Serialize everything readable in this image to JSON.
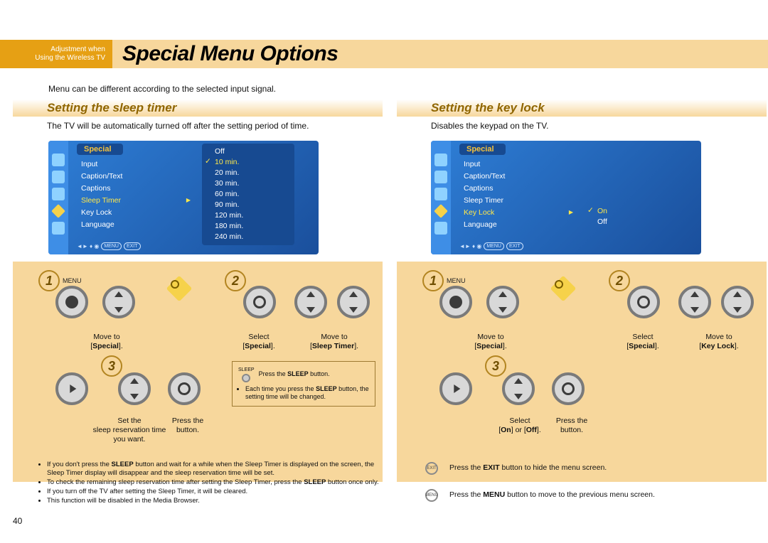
{
  "header": {
    "tab_line1": "Adjustment when",
    "tab_line2": "Using the Wireless TV",
    "title": "Special Menu Options"
  },
  "intro": "Menu can be different according to the selected input signal.",
  "page_number": "40",
  "sleep": {
    "title": "Setting the sleep timer",
    "desc": "The TV will be automatically turned off after the setting period of time.",
    "osd": {
      "title": "Special",
      "items": [
        "Input",
        "Caption/Text",
        "Captions",
        "Sleep Timer",
        "Key Lock",
        "Language"
      ],
      "selected": "Sleep Timer",
      "options": [
        "Off",
        "10 min.",
        "20 min.",
        "30 min.",
        "60 min.",
        "90 min.",
        "120 min.",
        "180 min.",
        "240 min."
      ],
      "option_selected": "10 min.",
      "foot_menu": "MENU",
      "foot_exit": "EXIT"
    },
    "step1": {
      "num": "1",
      "menu_label": "MENU",
      "caption1": "Move to",
      "caption2_b": "Special",
      "caption2": "[",
      "caption3": "]."
    },
    "step2": {
      "num": "2",
      "caption_a1": "Select",
      "caption_a2_b": "Special",
      "caption_a2": "[",
      "caption_a3": "].",
      "caption_b1": "Move to",
      "caption_b2_b": "Sleep Timer",
      "caption_b2": "[",
      "caption_b3": "]."
    },
    "step3": {
      "num": "3",
      "caption_a1": "Set the",
      "caption_a2": "sleep reservation time",
      "caption_a3": "you want.",
      "caption_b1": "Press the",
      "caption_b2": "button."
    },
    "note": {
      "header": "Press the ",
      "header_b": "SLEEP",
      "header2": " button.",
      "sleep_label": "SLEEP",
      "bullets": [
        "Each time you press the SLEEP button, the setting time will be changed."
      ]
    },
    "footer_bullets": [
      "If you don't press the SLEEP button and wait for a while when the Sleep Timer is displayed on the screen, the Sleep Timer display will disappear and the sleep reservation time will be set.",
      "To check the remaining sleep reservation time after setting the Sleep Timer, press the SLEEP button once only.",
      "If you turn off the TV after setting the Sleep Timer, it will be cleared.",
      "This function will be disabled in the Media Browser."
    ]
  },
  "keylock": {
    "title": "Setting the key lock",
    "desc": "Disables the keypad on the TV.",
    "osd": {
      "title": "Special",
      "items": [
        "Input",
        "Caption/Text",
        "Captions",
        "Sleep Timer",
        "Key Lock",
        "Language"
      ],
      "selected": "Key Lock",
      "option_on": "On",
      "option_off": "Off",
      "foot_menu": "MENU",
      "foot_exit": "EXIT"
    },
    "step1": {
      "num": "1",
      "menu_label": "MENU",
      "caption1": "Move to",
      "caption2_b": "Special",
      "caption2": "[",
      "caption3": "]."
    },
    "step2": {
      "num": "2",
      "caption_a1": "Select",
      "caption_a2_b": "Special",
      "caption_a2": "[",
      "caption_a3": "].",
      "caption_b1": "Move to",
      "caption_b2_b": "Key Lock",
      "caption_b2": "[",
      "caption_b3": "]."
    },
    "step3": {
      "num": "3",
      "caption_a1": "Select",
      "caption_a2_b1": "On",
      "caption_a2_mid": "] or [",
      "caption_a2_b2": "Off",
      "caption_a2": "[",
      "caption_a3": "].",
      "caption_b1": "Press the",
      "caption_b2": "button."
    },
    "exit_note": {
      "label": "EXIT",
      "text": "Press the EXIT button to hide the menu screen.",
      "text_b": "EXIT"
    },
    "menu_note": {
      "label": "MENU",
      "text": "Press the MENU button to move to the previous menu screen.",
      "text_b": "MENU"
    }
  }
}
